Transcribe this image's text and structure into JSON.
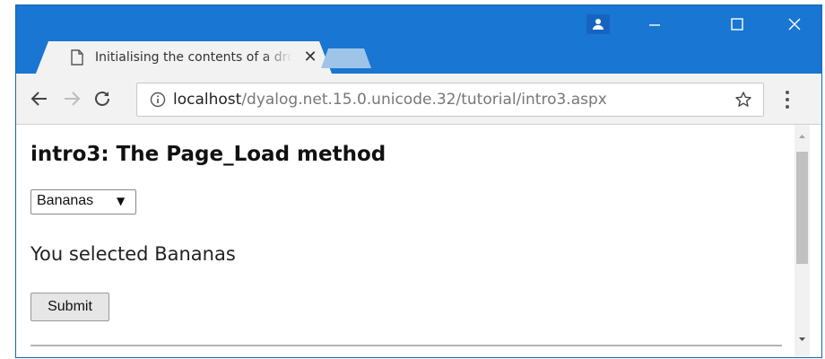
{
  "browser": {
    "tab": {
      "title": "Initialising the contents of a dropdown",
      "close_glyph": "✕"
    },
    "address_bar": {
      "host": "localhost",
      "path": "/dyalog.net.15.0.unicode.32/tutorial/intro3.aspx"
    }
  },
  "page": {
    "title": "intro3: The Page_Load method",
    "dropdown": {
      "selected": "Bananas",
      "arrow": "▼"
    },
    "message": "You selected Bananas",
    "submit_label": "Submit"
  },
  "colors": {
    "titlebar": "#1976d2",
    "toolbar": "#f2f2f2",
    "new_tab": "#9ec5e8"
  },
  "icons": [
    "page-icon",
    "close-icon",
    "profile-icon",
    "minimize-icon",
    "maximize-icon",
    "window-close-icon",
    "back-arrow-icon",
    "forward-arrow-icon",
    "reload-icon",
    "info-icon",
    "star-icon",
    "menu-icon"
  ]
}
